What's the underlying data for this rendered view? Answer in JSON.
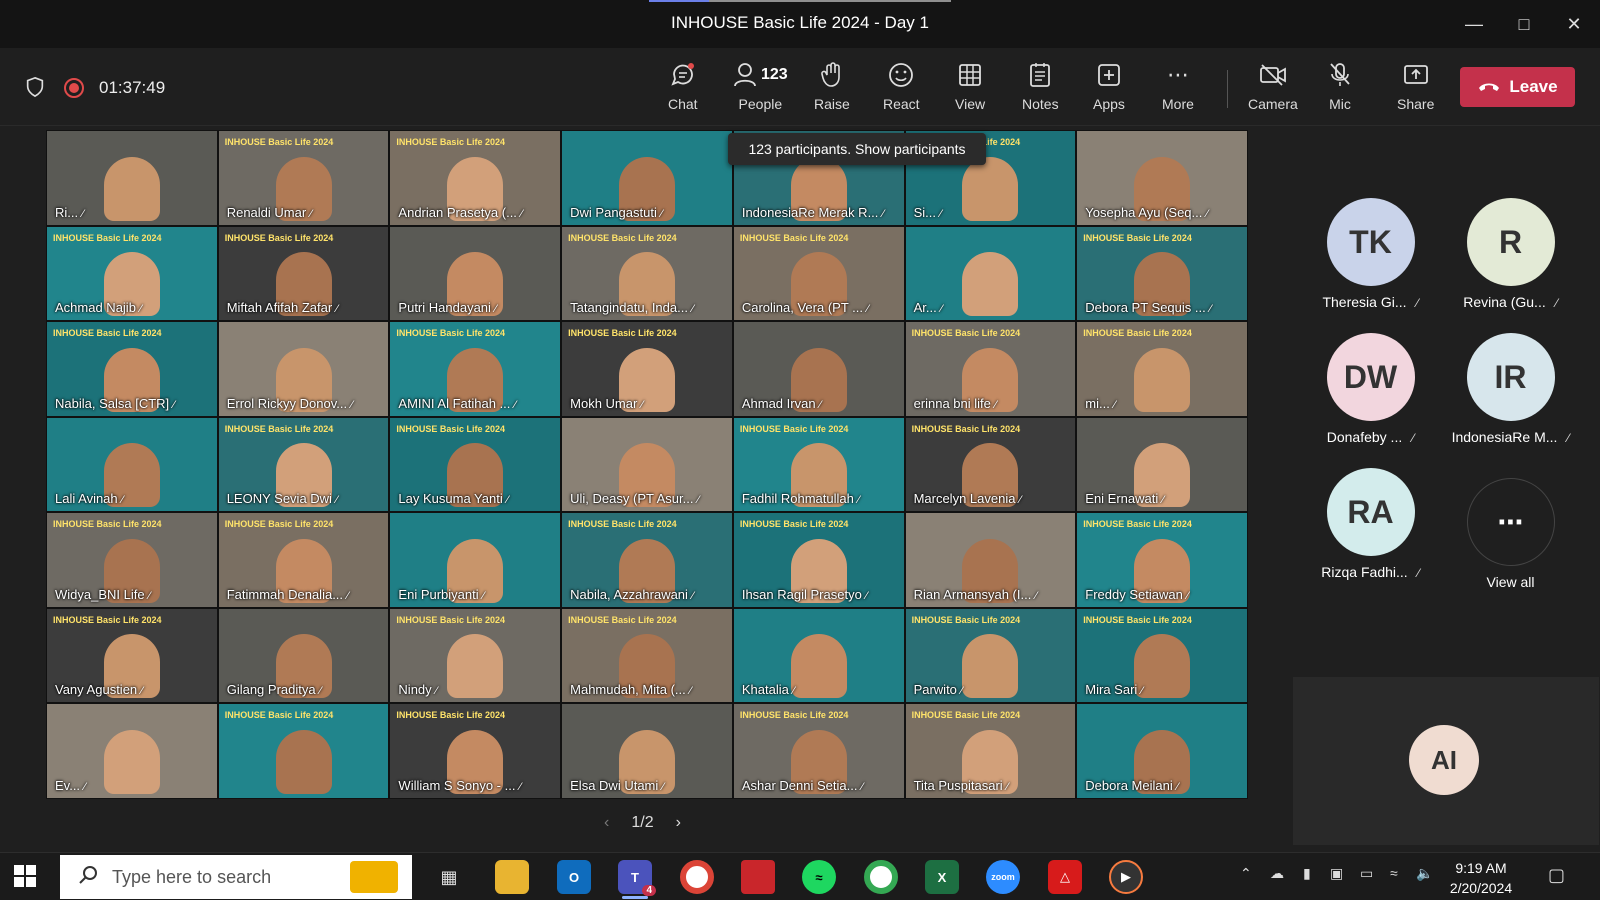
{
  "window": {
    "title": "INHOUSE Basic Life 2024 - Day 1"
  },
  "toolbar": {
    "timer": "01:37:49",
    "chat": "Chat",
    "people_count": "123",
    "people": "People",
    "raise": "Raise",
    "react": "React",
    "view": "View",
    "notes": "Notes",
    "apps": "Apps",
    "more": "More",
    "camera": "Camera",
    "mic": "Mic",
    "share": "Share",
    "leave": "Leave"
  },
  "tooltip": "123 participants. Show participants",
  "tiles": [
    "Ri...",
    "Renaldi Umar",
    "Andrian Prasetya (...",
    "Dwi Pangastuti",
    "IndonesiaRe Merak R...",
    "Si...",
    "Yosepha Ayu (Seq...",
    "Achmad Najib",
    "Miftah Afifah Zafar",
    "Putri Handayani",
    "Tatangindatu, Inda...",
    "Carolina, Vera (PT ...",
    "Ar...",
    "Debora PT Sequis ...",
    "Nabila, Salsa [CTR]",
    "Errol Rickyy Donov...",
    "AMINI Al Fatihah ...",
    "Mokh Umar",
    "Ahmad Irvan",
    "erinna bni life",
    "mi...",
    "Lali Avinah",
    "LEONY Sevia Dwi",
    "Lay Kusuma Yanti",
    "Uli, Deasy (PT Asur...",
    "Fadhil Rohmatullah",
    "Marcelyn Lavenia",
    "Eni Ernawati",
    "Widya_BNI Life",
    "Fatimmah Denalia...",
    "Eni Purbiyanti",
    "Nabila, Azzahrawani",
    "Ihsan Ragil Prasetyo",
    "Rian Armansyah (I...",
    "Freddy Setiawan",
    "Vany Agustien",
    "Gilang Praditya",
    "Nindy",
    "Mahmudah, Mita (...",
    "Khatalia",
    "Parwito",
    "Mira Sari",
    "Ev...",
    "",
    "William S Sonyo - ...",
    "Elsa Dwi Utami",
    "Ashar Denni Setia...",
    "Tita Puspitasari",
    "Debora Meilani"
  ],
  "slide_brand": "INHOUSE Basic Life 2024",
  "pager": {
    "label": "1/2"
  },
  "side_participants": [
    {
      "initials": "TK",
      "name": "Theresia Gi...",
      "color": "#c9d3ea"
    },
    {
      "initials": "R",
      "name": "Revina (Gu...",
      "color": "#e3ead6"
    },
    {
      "initials": "DW",
      "name": "Donafeby ...",
      "color": "#f2d6de"
    },
    {
      "initials": "IR",
      "name": "IndonesiaRe M...",
      "color": "#d7e6ec"
    },
    {
      "initials": "RA",
      "name": "Rizqa Fadhi...",
      "color": "#d3ecec"
    }
  ],
  "view_all": "View all",
  "self_initials": "AI",
  "taskbar": {
    "search_placeholder": "Type here to search",
    "time": "9:19 AM",
    "date": "2/20/2024",
    "teams_badge": "4"
  },
  "colors": {
    "leave": "#c4314b",
    "teal_slide": "#1f7f86",
    "record": "#e04a4a"
  }
}
